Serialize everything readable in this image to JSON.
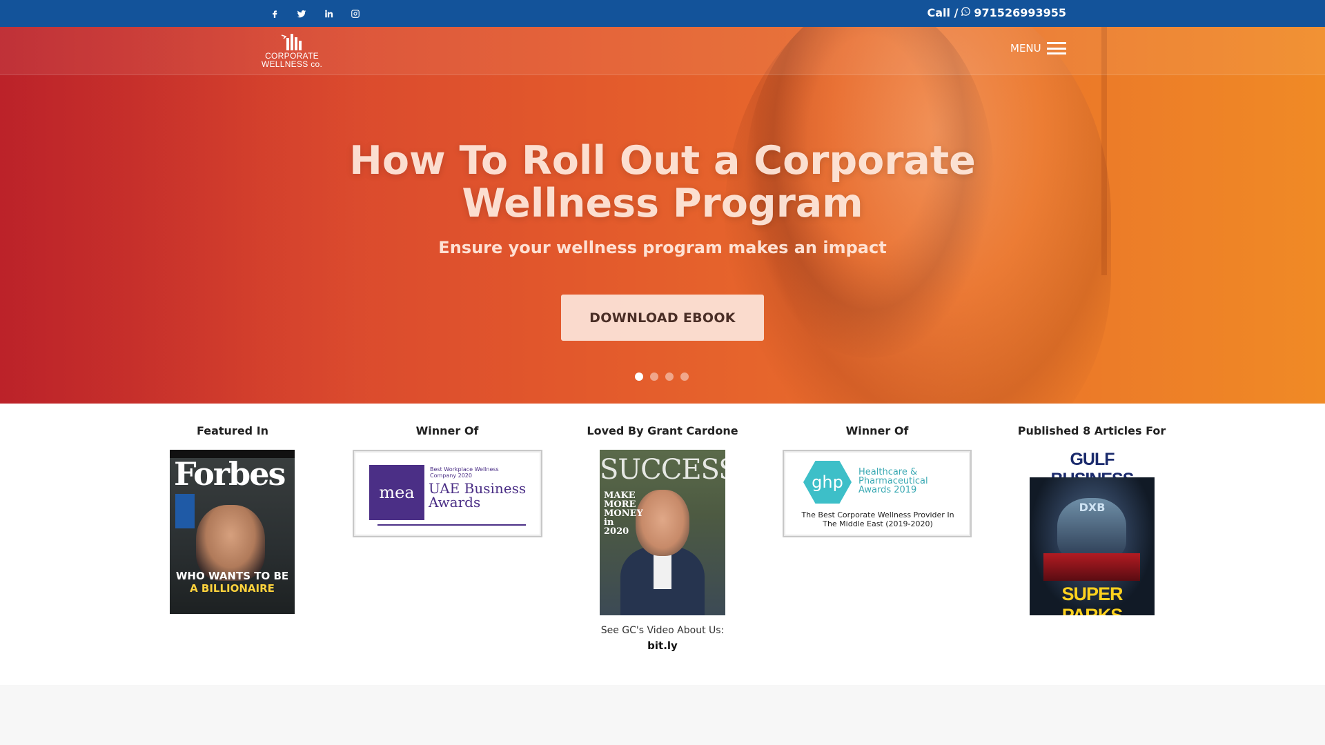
{
  "topbar": {
    "social": [
      {
        "name": "facebook-icon"
      },
      {
        "name": "twitter-icon"
      },
      {
        "name": "linkedin-icon"
      },
      {
        "name": "instagram-icon"
      }
    ],
    "call_prefix": "Call /",
    "phone": "971526993955",
    "colors": {
      "bar": "#13539a"
    }
  },
  "header": {
    "logo_line1": "CORPORATE",
    "logo_line2": "WELLNESS co.",
    "menu_label": "MENU"
  },
  "hero": {
    "title": "How To Roll Out a Corporate Wellness Program",
    "subtitle": "Ensure your wellness program makes an impact",
    "button_label": "DOWNLOAD EBOOK",
    "slides": 4,
    "active_slide": 1,
    "colors": {
      "left": "#c52a2f",
      "right": "#f08a25"
    }
  },
  "press": {
    "featured": {
      "heading": "Featured In",
      "cover_masthead": "Forbes",
      "cover_line1": "WHO WANTS TO BE",
      "cover_line2": "A BILLIONAIRE"
    },
    "winner1": {
      "heading": "Winner Of",
      "logo_text": "mea",
      "small": "Best Workplace Wellness Company 2020",
      "big": "UAE Business Awards"
    },
    "loved": {
      "heading": "Loved By Grant Cardone",
      "cover_masthead": "SUCCESS",
      "cover_side": "MAKE MORE MONEY in 2020",
      "note": "See GC's Video About Us:",
      "link": "bit.ly"
    },
    "winner2": {
      "heading": "Winner Of",
      "logo_text": "ghp",
      "award": "Healthcare & Pharmaceutical Awards 2019",
      "caption": "The Best Corporate Wellness Provider In The Middle East (2019-2020)"
    },
    "published": {
      "heading": "Published 8 Articles For",
      "cover_masthead": "GULF BUSINESS",
      "cover_tag": "DXB",
      "cover_headline": "SUPER PARKS"
    }
  }
}
